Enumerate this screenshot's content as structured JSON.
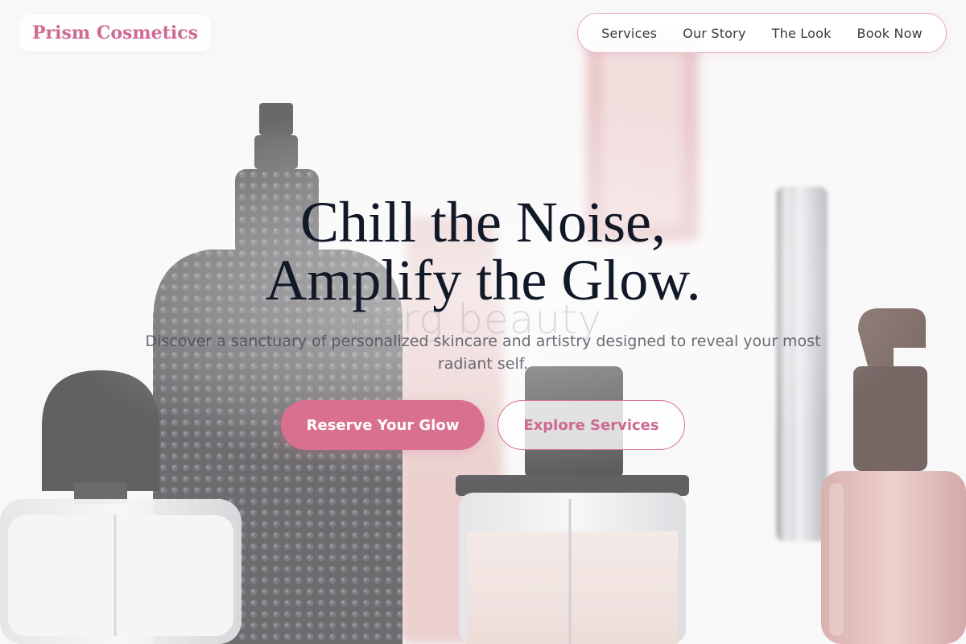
{
  "brand": {
    "name": "Prism Cosmetics",
    "color": "#cf6a92"
  },
  "nav": {
    "items": [
      {
        "label": "Services"
      },
      {
        "label": "Our Story"
      },
      {
        "label": "The Look"
      },
      {
        "label": "Book Now"
      }
    ]
  },
  "hero": {
    "title_line1": "Chill the Noise,",
    "title_line2": "Amplify the Glow.",
    "subtitle": "Discover a sanctuary of personalized skincare and artistry designed to reveal your most radiant self.",
    "primary_button": "Reserve Your Glow",
    "secondary_button": "Explore Services"
  },
  "background": {
    "watermark": "iceberg beauty",
    "subject": "perfume-bottles-photo"
  },
  "colors": {
    "accent": "#d9708f",
    "heading": "#111827",
    "nav_border": "#e6a9bf"
  }
}
